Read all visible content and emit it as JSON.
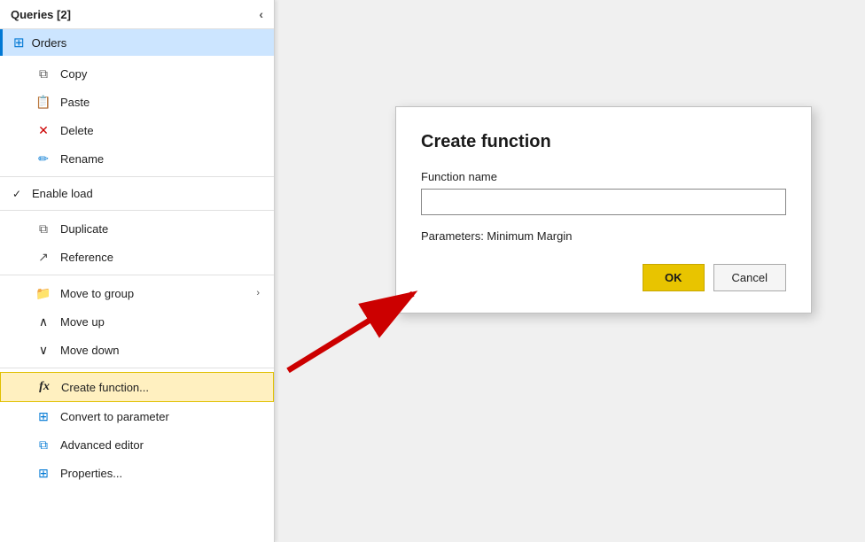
{
  "panel": {
    "header": "Queries [2]",
    "collapse_label": "‹",
    "query_name": "Orders"
  },
  "menu": {
    "items": [
      {
        "id": "copy",
        "label": "Copy",
        "icon": "copy",
        "indent": true
      },
      {
        "id": "paste",
        "label": "Paste",
        "icon": "paste",
        "indent": true
      },
      {
        "id": "delete",
        "label": "Delete",
        "icon": "delete",
        "indent": true
      },
      {
        "id": "rename",
        "label": "Rename",
        "icon": "rename",
        "indent": true
      },
      {
        "id": "enable-load",
        "label": "Enable load",
        "icon": "check",
        "indent": false,
        "check": true
      },
      {
        "id": "duplicate",
        "label": "Duplicate",
        "icon": "duplicate",
        "indent": true
      },
      {
        "id": "reference",
        "label": "Reference",
        "icon": "reference",
        "indent": true
      },
      {
        "id": "move-to-group",
        "label": "Move to group",
        "icon": "folder",
        "indent": true,
        "hasArrow": true
      },
      {
        "id": "move-up",
        "label": "Move up",
        "icon": "moveup",
        "indent": true
      },
      {
        "id": "move-down",
        "label": "Move down",
        "icon": "movedown",
        "indent": true
      },
      {
        "id": "create-function",
        "label": "Create function...",
        "icon": "fx",
        "indent": true,
        "highlighted": true
      },
      {
        "id": "convert-param",
        "label": "Convert to parameter",
        "icon": "convert",
        "indent": true
      },
      {
        "id": "advanced-editor",
        "label": "Advanced editor",
        "icon": "advanced",
        "indent": true
      },
      {
        "id": "properties",
        "label": "Properties...",
        "icon": "properties",
        "indent": true
      }
    ]
  },
  "dialog": {
    "title": "Create function",
    "function_name_label": "Function name",
    "function_name_placeholder": "",
    "params_label": "Parameters: Minimum Margin",
    "ok_label": "OK",
    "cancel_label": "Cancel"
  }
}
